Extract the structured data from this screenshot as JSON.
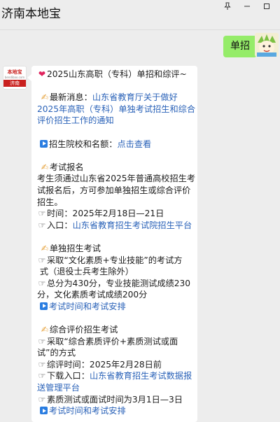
{
  "window": {
    "title": "济南本地宝"
  },
  "outgoing": {
    "text": "单招"
  },
  "bot": {
    "logo_top": "本地宝",
    "logo_url": "bendibao.com",
    "logo_bar": "济南"
  },
  "message": {
    "line1": "2025山东高职（专科）单招和综评~",
    "notice_label": "最新消息：",
    "notice_link_1": "山东省教育厅关于做好",
    "notice_link_2": "2025年高职（专科）单独考试招生和综合",
    "notice_link_3": "评价招生工作的通知",
    "schools_label": "招生院校和名额：",
    "schools_link": "点击查看",
    "signup_title": "考试报名",
    "signup_1": "考生须通过山东省2025年普通高校招生考",
    "signup_2": "试报名后，方可参加单独招生或综合评价",
    "signup_3": "招生。",
    "signup_time": "时间：2025年2月18日—21日",
    "signup_entry_label": "入口：",
    "signup_entry_link": "山东省教育招生考试院招生平台",
    "single_title": "单独招生考试",
    "single_1": "采取“文化素质+专业技能”的考试方",
    "single_2": "式（退役士兵考生除外）",
    "single_3": "总分为430分，专业技能测试成绩230",
    "single_4": "分，文化素质考试成绩200分",
    "single_link": "考试时间和考试安排",
    "comp_title": "综合评价招生考试",
    "comp_1": "采取“综合素质评价+素质测试或面",
    "comp_2": "试”的方式",
    "comp_3": "综评时间：2025年2月28日前",
    "comp_download_label": "下载入口：",
    "comp_download_link_1": "山东省教育招生考试数据报",
    "comp_download_link_2": "送管理平台",
    "comp_4": "素质测试或面试时间为3月1日—3日",
    "comp_link": "考试时间和考试安排"
  }
}
